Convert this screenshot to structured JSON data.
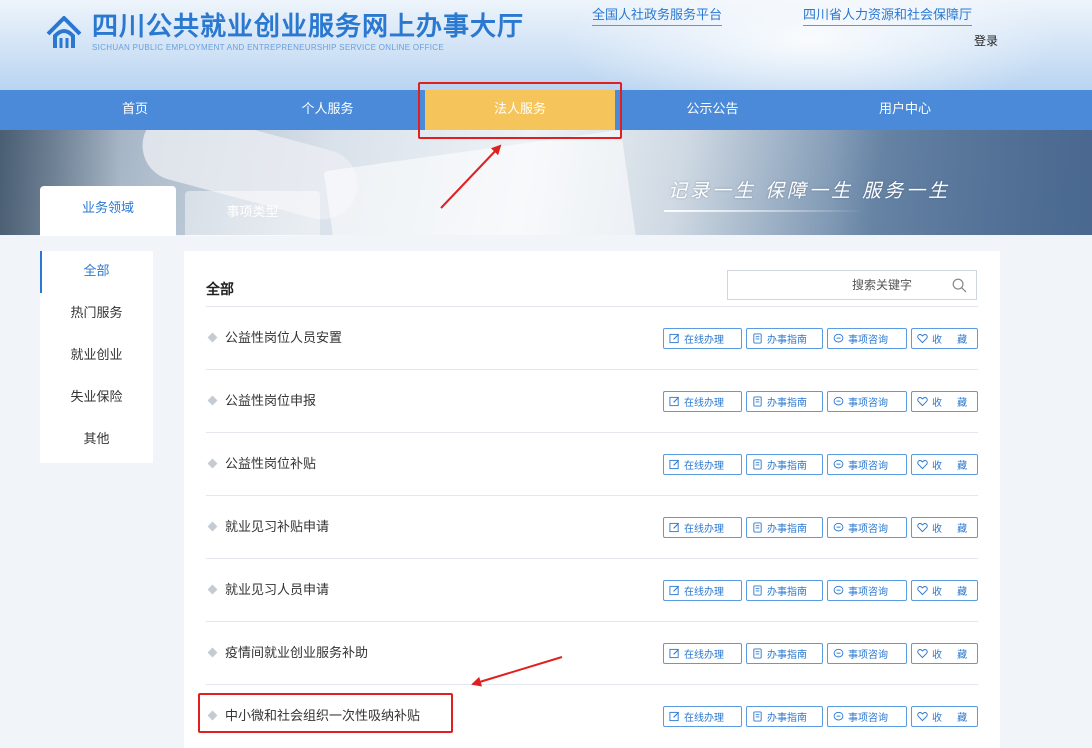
{
  "header": {
    "title": "四川公共就业创业服务网上办事大厅",
    "subtitle": "SICHUAN PUBLIC EMPLOYMENT AND ENTREPRENEURSHIP SERVICE ONLINE OFFICE",
    "links": [
      "全国人社政务服务平台",
      "四川省人力资源和社会保障厅"
    ],
    "login": "登录",
    "logo_icon": "sichuan-logo-icon"
  },
  "nav": {
    "items": [
      "首页",
      "个人服务",
      "法人服务",
      "公示公告",
      "用户中心"
    ],
    "active_index": 2
  },
  "banner": {
    "slogan": "记录一生  保障一生  服务一生"
  },
  "tabs": [
    "业务领域",
    "事项类型"
  ],
  "sidebar": {
    "items": [
      "全部",
      "热门服务",
      "就业创业",
      "失业保险",
      "其他"
    ],
    "active_index": 0
  },
  "main": {
    "title": "全部",
    "search": {
      "placeholder": "搜索关键字",
      "icon": "search-icon"
    },
    "actions": [
      "在线办理",
      "办事指南",
      "事项咨询",
      "收  藏"
    ],
    "rows": [
      "公益性岗位人员安置",
      "公益性岗位申报",
      "公益性岗位补贴",
      "就业见习补贴申请",
      "就业见习人员申请",
      "疫情间就业创业服务补助",
      "中小微和社会组织一次性吸纳补贴"
    ]
  },
  "colors": {
    "brand_blue": "#2a78d0",
    "nav_blue": "#4a8ad8",
    "nav_active": "#f5c45a",
    "highlight_red": "#e02020"
  }
}
